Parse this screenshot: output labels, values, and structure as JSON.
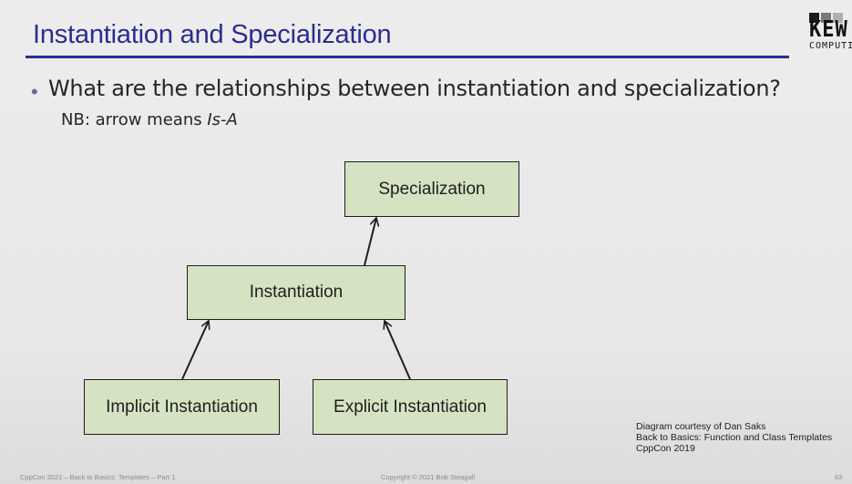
{
  "slide": {
    "title": "Instantiation and Specialization",
    "bullet_symbol": "•",
    "question": "What are the relationships between instantiation and specialization?",
    "note_prefix": "NB: arrow means ",
    "note_emphasis": "Is-A"
  },
  "logo": {
    "text": "KEW",
    "subtext": "COMPUTI",
    "square_colors": [
      "#1a1a1a",
      "#7a7a7a",
      "#b0b0b0"
    ]
  },
  "diagram": {
    "box_fill": "#d5e3c3",
    "nodes": {
      "specialization": "Specialization",
      "instantiation": "Instantiation",
      "implicit": "Implicit Instantiation",
      "explicit": "Explicit Instantiation"
    },
    "edges": [
      {
        "from": "instantiation",
        "to": "specialization"
      },
      {
        "from": "implicit",
        "to": "instantiation"
      },
      {
        "from": "explicit",
        "to": "instantiation"
      }
    ]
  },
  "credit": {
    "line1": "Diagram courtesy of Dan Saks",
    "line2": "Back to Basics: Function and Class Templates",
    "line3": "CppCon 2019"
  },
  "footer": {
    "left": "CppCon 2021 – Back to Basics: Templates – Part 1",
    "center": "Copyright © 2021 Bob Steagall",
    "page_number": "63"
  }
}
